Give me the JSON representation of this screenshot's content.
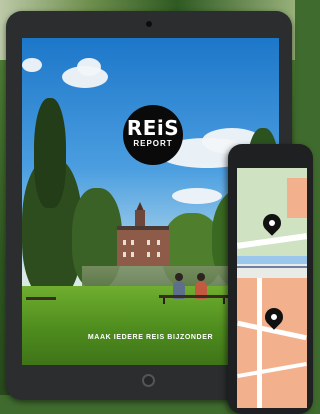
{
  "cover": {
    "logo_main": "REiS",
    "logo_sub": "REPORT",
    "tagline": "MAAK IEDERE REIS BIJZONDER"
  },
  "icons": {
    "camera": "camera-icon",
    "home": "home-button-icon",
    "map_pin": "map-pin-icon"
  },
  "colors": {
    "device": "#2c2d2f",
    "logo_bg": "#0a0a0a",
    "sky": "#1d77c9",
    "grass": "#4e8c1e",
    "map_orange": "#f3b08d",
    "map_blue": "#9cc7ec"
  }
}
